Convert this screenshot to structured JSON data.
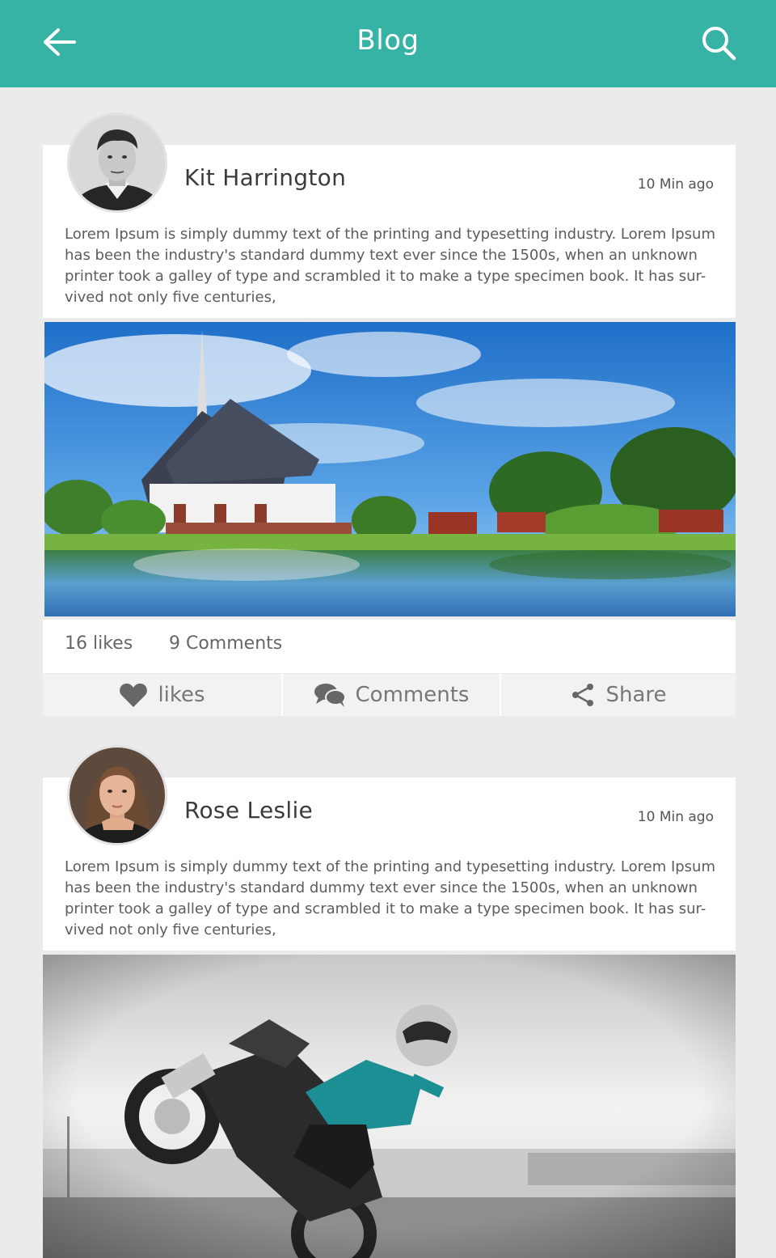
{
  "header": {
    "title": "Blog",
    "back_icon": "arrow-left-icon",
    "search_icon": "search-icon",
    "background": "#36b3a5"
  },
  "posts": [
    {
      "author": "Kit Harrington",
      "time": "10 Min ago",
      "body": "Lorem Ipsum is simply dummy text of the printing and typesetting industry. Lorem Ipsum has been the industry's standard dummy text ever since the 1500s, when an unknown printer took a galley of type and scrambled it to make a type specimen book. It has sur-vived not only five centuries,",
      "likes_count": "16 likes",
      "comments_count": "9 Comments",
      "actions": {
        "like": "likes",
        "comment": "Comments",
        "share": "Share"
      }
    },
    {
      "author": "Rose Leslie",
      "time": "10 Min ago",
      "body": "Lorem Ipsum is simply dummy text of the printing and typesetting industry. Lorem Ipsum has been the industry's standard dummy text ever since the 1500s, when an unknown printer took a galley of type and scrambled it to make a type specimen book. It has sur-vived not only five centuries,"
    }
  ]
}
